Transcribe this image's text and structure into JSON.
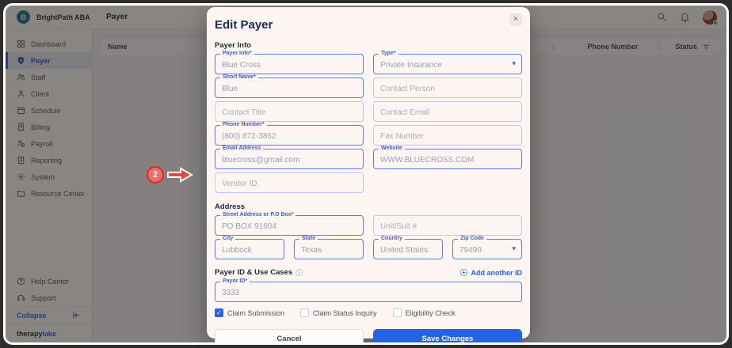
{
  "topbar": {
    "brand": "BrightPath ABA",
    "logo_letter": "B",
    "page_title": "Payer"
  },
  "sidebar": {
    "items": [
      {
        "label": "Dashboard",
        "active": false
      },
      {
        "label": "Payer",
        "active": true
      },
      {
        "label": "Staff",
        "active": false
      },
      {
        "label": "Client",
        "active": false
      },
      {
        "label": "Schedule",
        "active": false
      },
      {
        "label": "Billing",
        "active": false
      },
      {
        "label": "Payroll",
        "active": false
      },
      {
        "label": "Reporting",
        "active": false
      },
      {
        "label": "System",
        "active": false
      },
      {
        "label": "Resource Center",
        "active": false
      }
    ],
    "help_items": [
      {
        "label": "Help Center"
      },
      {
        "label": "Support"
      }
    ],
    "collapse_label": "Collapse",
    "footer_brand_primary": "therapy",
    "footer_brand_secondary": "lake"
  },
  "table": {
    "columns": [
      "Name",
      "Phone Number",
      "Status"
    ],
    "kebab_icon": "⋮"
  },
  "annotation": {
    "number": "2"
  },
  "modal": {
    "title": "Edit Payer",
    "close_icon": "×",
    "section_payer_info": "Payer Info",
    "section_address": "Address",
    "section_payer_id": "Payer ID & Use Cases",
    "info_icon": "ⓘ",
    "add_another_id": "Add another ID",
    "caret_icon": "▾",
    "fields": {
      "payer_info": {
        "label": "Payer Info*",
        "value": "Blue Cross"
      },
      "type": {
        "label": "Type*",
        "value": "Private Insurance"
      },
      "short_name": {
        "label": "Short Name*",
        "value": "Blue"
      },
      "contact_person": {
        "placeholder": "Contact Person"
      },
      "contact_title": {
        "placeholder": "Contact Title"
      },
      "contact_email": {
        "placeholder": "Contact Email"
      },
      "phone_number": {
        "label": "Phone Number*",
        "value": "(800) 872-3862"
      },
      "fax_number": {
        "placeholder": "Fax Number"
      },
      "email_address": {
        "label": "Email Address",
        "value": "bluecross@gmail.com"
      },
      "website": {
        "label": "Website",
        "value": "WWW.BLUECROSS.COM"
      },
      "vendor_id": {
        "placeholder": "Vendor ID"
      },
      "street": {
        "label": "Street Address or P.O Box*",
        "value": "PO BOX 91604"
      },
      "unit": {
        "placeholder": "Unit/Suit #"
      },
      "city": {
        "label": "City",
        "value": "Lubbock"
      },
      "state": {
        "label": "State",
        "value": "Texas"
      },
      "country": {
        "label": "Country",
        "value": "United States"
      },
      "zip": {
        "label": "Zip Code",
        "value": "79490"
      },
      "payor_id": {
        "label": "Payor ID*",
        "value": "3333"
      }
    },
    "checkboxes": [
      {
        "label": "Claim Submission",
        "checked": true
      },
      {
        "label": "Claim Status Inquiry",
        "checked": false
      },
      {
        "label": "Eligibility Check",
        "checked": false
      }
    ],
    "cancel_label": "Cancel",
    "save_label": "Save Changes",
    "check_glyph": "✓"
  },
  "colors": {
    "accent_blue": "#2563eb",
    "field_border_filled": "#5d7ce2",
    "field_border_empty": "#bcc8ef",
    "save_button": "#2463e8",
    "annotation_red": "#d92b2b",
    "active_nav_bg": "#e4ecfb",
    "logo_teal": "#0e7490",
    "online_dot_green": "#22c55e"
  }
}
